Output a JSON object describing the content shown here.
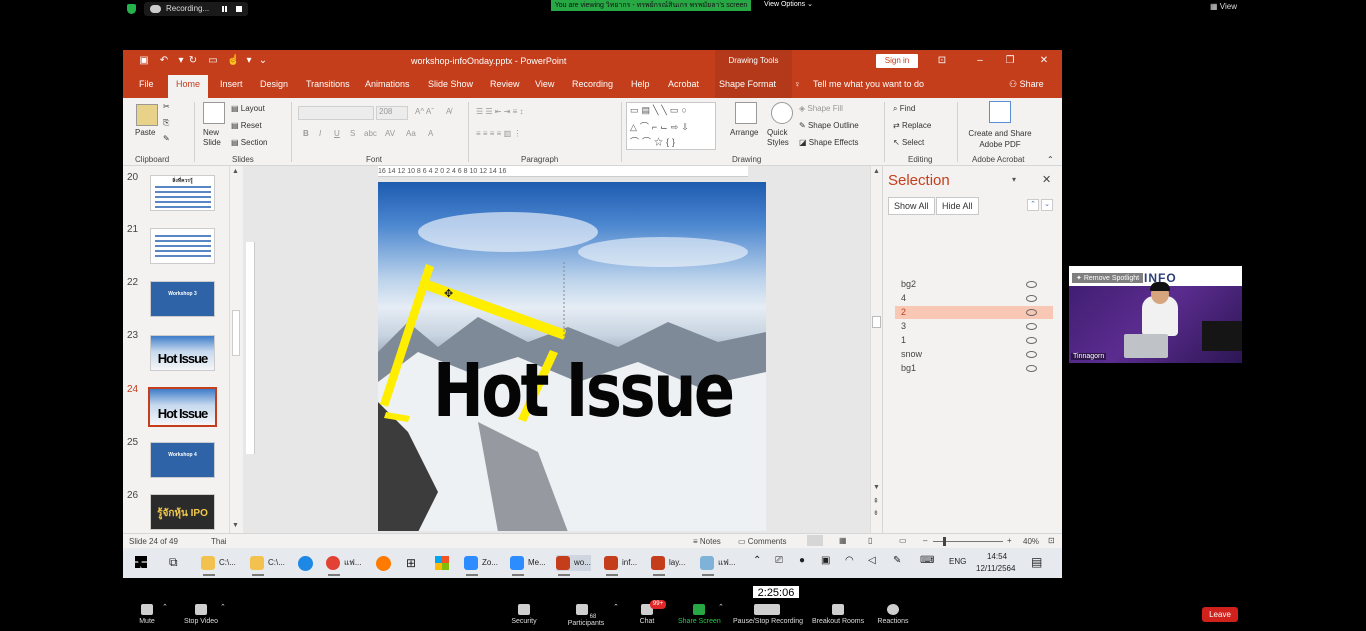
{
  "zoom": {
    "recording_label": "Recording...",
    "viewing_banner": "You are viewing วิทยากร - ทรพย์กรณ์สินเกร พรพมัยลา's screen",
    "view_options": "View Options",
    "view_button": "View",
    "timer": "2:25:06",
    "controls": {
      "mute": "Mute",
      "stop_video": "Stop Video",
      "security": "Security",
      "participants": "Participants",
      "participants_count": "68",
      "chat": "Chat",
      "chat_badge": "99+",
      "share_screen": "Share Screen",
      "pause_recording": "Pause/Stop Recording",
      "breakout": "Breakout Rooms",
      "reactions": "Reactions",
      "leave": "Leave"
    },
    "video": {
      "remove_spotlight": "Remove Spotlight",
      "banner": "INFO",
      "participant_name": "Tinnagorn"
    }
  },
  "ppt": {
    "title": "workshop-infoOnday.pptx  -  PowerPoint",
    "drawing_tools": "Drawing Tools",
    "sign_in": "Sign in",
    "tabs": [
      "File",
      "Home",
      "Insert",
      "Design",
      "Transitions",
      "Animations",
      "Slide Show",
      "Review",
      "View",
      "Recording",
      "Help",
      "Acrobat",
      "Shape Format"
    ],
    "tell_me": "Tell me what you want to do",
    "share": "Share",
    "ribbon": {
      "paste": "Paste",
      "new_slide": "New Slide",
      "layout": "Layout",
      "reset": "Reset",
      "section": "Section",
      "font_size": "208",
      "arrange": "Arrange",
      "quick_styles": "Quick Styles",
      "shape_fill": "Shape Fill",
      "shape_outline": "Shape Outline",
      "shape_effects": "Shape Effects",
      "find": "Find",
      "replace": "Replace",
      "select": "Select",
      "create_share_pdf": "Create and Share Adobe PDF",
      "groups": {
        "clipboard": "Clipboard",
        "slides": "Slides",
        "font": "Font",
        "paragraph": "Paragraph",
        "drawing": "Drawing",
        "editing": "Editing",
        "adobe": "Adobe Acrobat"
      }
    },
    "slides": [
      {
        "num": "20",
        "caption": "สิ่งที่ควรรู้"
      },
      {
        "num": "21",
        "caption": ""
      },
      {
        "num": "22",
        "caption": "Workshop 3"
      },
      {
        "num": "23",
        "caption": "Hot Issue"
      },
      {
        "num": "24",
        "caption": "Hot Issue"
      },
      {
        "num": "25",
        "caption": "Workshop 4"
      },
      {
        "num": "26",
        "caption": "รู้จักหุ้น IPO"
      }
    ],
    "slide_title": "Hot Issue",
    "ruler_text": "16 14 12 10 8 6 4 2 0 2 4 6 8 10 12 14 16",
    "selection": {
      "title": "Selection",
      "show_all": "Show All",
      "hide_all": "Hide All",
      "items": [
        "bg2",
        "4",
        "2",
        "3",
        "1",
        "snow",
        "bg1"
      ]
    },
    "status": {
      "slide_of": "Slide 24 of 49",
      "language": "Thai",
      "notes": "Notes",
      "comments": "Comments",
      "zoom": "40%"
    }
  },
  "taskbar": {
    "items": [
      "C:\\...",
      "C:\\...",
      "แฟ...",
      "Zo...",
      "Me...",
      "wo...",
      "inf...",
      "lay...",
      "แฟ..."
    ],
    "lang": "ENG",
    "time": "14:54",
    "date": "12/11/2564"
  },
  "colors": {
    "ppt_accent": "#c43e1c",
    "selection_highlight": "#f8c8b5",
    "zoom_green": "#28a745",
    "leave_red": "#d0211c",
    "shape_yellow": "#ffee00"
  }
}
